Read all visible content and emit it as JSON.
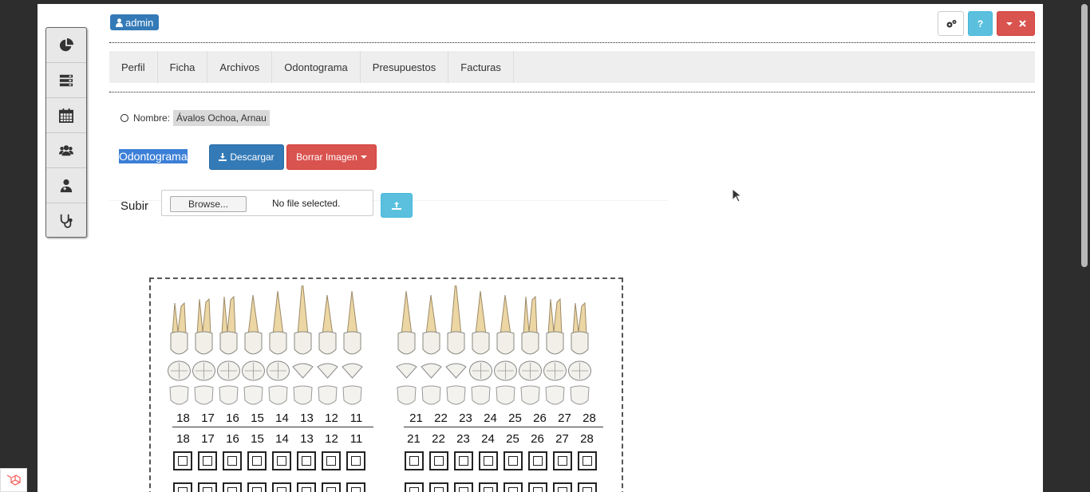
{
  "header": {
    "user": "admin",
    "help_label": "?"
  },
  "sidebar": {
    "items": [
      {
        "icon": "pie-chart-icon"
      },
      {
        "icon": "server-icon"
      },
      {
        "icon": "calendar-icon"
      },
      {
        "icon": "users-icon"
      },
      {
        "icon": "user-md-icon"
      },
      {
        "icon": "stethoscope-icon"
      }
    ]
  },
  "tabs": [
    "Perfil",
    "Ficha",
    "Archivos",
    "Odontograma",
    "Presupuestos",
    "Facturas"
  ],
  "patient": {
    "name_label": "Nombre:",
    "name_value": "Ávalos Ochoa, Arnau"
  },
  "odontograma": {
    "title": "Odontograma",
    "download_label": "Descargar",
    "delete_label": "Borrar Imagen"
  },
  "upload": {
    "label": "Subir",
    "browse_label": "Browse...",
    "file_status": "No file selected."
  },
  "chart_image": {
    "upper_labels_left": [
      "18",
      "17",
      "16",
      "15",
      "14",
      "13",
      "12",
      "11"
    ],
    "upper_labels_right": [
      "21",
      "22",
      "23",
      "24",
      "25",
      "26",
      "27",
      "28"
    ],
    "numbers_left": [
      "18",
      "17",
      "16",
      "15",
      "14",
      "13",
      "12",
      "11"
    ],
    "numbers_right": [
      "21",
      "22",
      "23",
      "24",
      "25",
      "26",
      "27",
      "28"
    ]
  },
  "colors": {
    "primary": "#337ab7",
    "danger": "#d9534f",
    "info": "#5bc0de"
  }
}
